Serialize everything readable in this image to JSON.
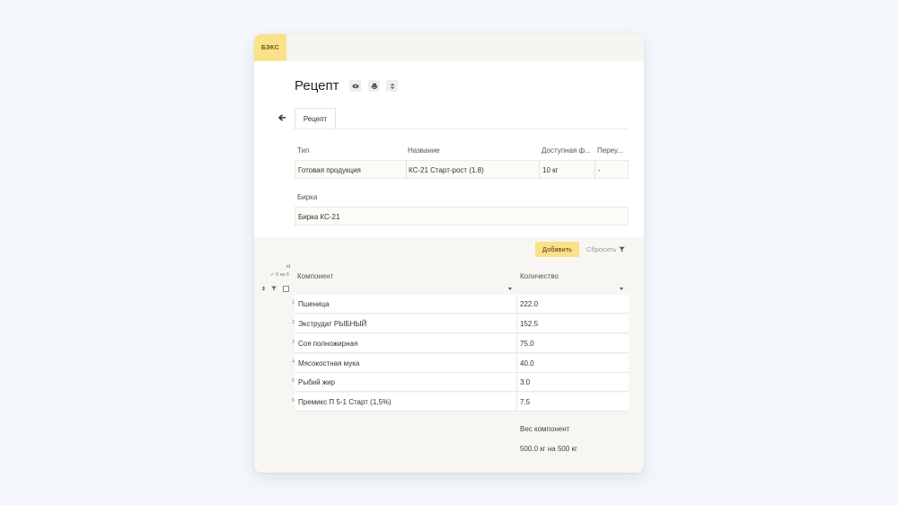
{
  "header": {
    "brand": "БЭКС"
  },
  "page": {
    "title": "Рецепт"
  },
  "tabs": [
    {
      "label": "Рецепт"
    }
  ],
  "info_table": {
    "headers": [
      "Тип",
      "Название",
      "Доступная ф...",
      "Переу..."
    ],
    "row": [
      "Готовая продукция",
      "КС-21 Старт-рост (1.8)",
      "10 кг",
      "-"
    ]
  },
  "tag": {
    "label": "Бирка",
    "value": "Бирка КС-21"
  },
  "toolbar": {
    "add_label": "Добавить",
    "reset_label": "Сбросить"
  },
  "components_table": {
    "id_header": "id",
    "select_label": "✓ 0 из 6",
    "headers": [
      "Компонент",
      "Количество"
    ],
    "rows": [
      {
        "id": "1",
        "component": "Пшеница",
        "quantity": "222.0"
      },
      {
        "id": "2",
        "component": "Экструдат РЫБНЫЙ",
        "quantity": "152.5"
      },
      {
        "id": "3",
        "component": "Соя полножирная",
        "quantity": "75.0"
      },
      {
        "id": "4",
        "component": "Мясокостная мука",
        "quantity": "40.0"
      },
      {
        "id": "5",
        "component": "Рыбий жир",
        "quantity": "3.0"
      },
      {
        "id": "6",
        "component": "Премикс П 5-1 Старт (1,5%)",
        "quantity": "7.5"
      }
    ]
  },
  "footer": {
    "weight_label": "Вес компонент",
    "weight_value": "500.0 кг на 500 кг"
  },
  "icons": [
    "eye-icon",
    "print-icon",
    "sort-icon",
    "back-arrow-icon",
    "filter-icon",
    "chevron-down-icon",
    "checkbox-icon"
  ],
  "colors": {
    "accent": "#fbe08a",
    "page_bg": "#f4f7fb",
    "cell_bg": "#fcfbf5"
  }
}
